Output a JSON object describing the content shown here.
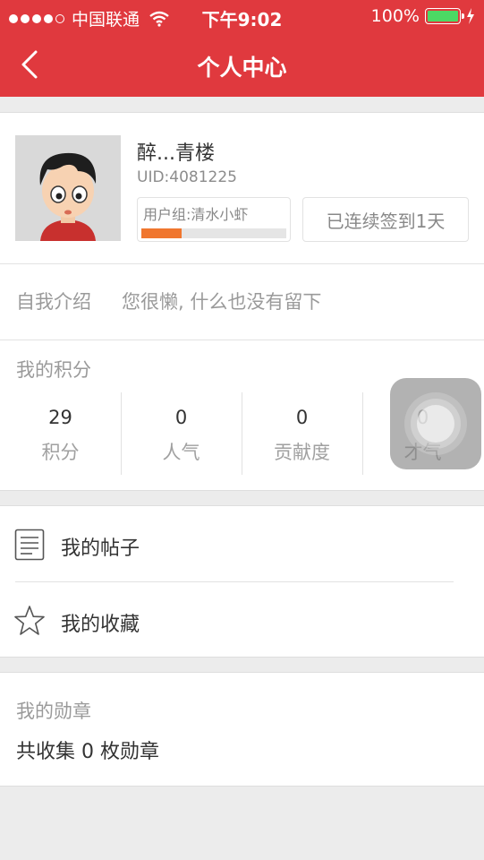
{
  "status_bar": {
    "carrier": "中国联通",
    "time": "下午9:02",
    "battery": "100%"
  },
  "navbar": {
    "title": "个人中心",
    "back_icon": "chevron-left-icon"
  },
  "profile": {
    "username": "醉...青楼",
    "uid": "UID:4081225",
    "group": "用户组:清水小虾",
    "group_progress": 0.28,
    "signin": "已连续签到1天"
  },
  "intro": {
    "label": "自我介绍",
    "text": "您很懒, 什么也没有留下"
  },
  "points": {
    "title": "我的积分",
    "items": [
      {
        "value": "29",
        "label": "积分"
      },
      {
        "value": "0",
        "label": "人气"
      },
      {
        "value": "0",
        "label": "贡献度"
      },
      {
        "value": "0",
        "label": "才气"
      }
    ]
  },
  "menu": {
    "items": [
      {
        "label": "我的帖子",
        "icon": "document-icon"
      },
      {
        "label": "我的收藏",
        "icon": "star-icon"
      }
    ]
  },
  "medals": {
    "title": "我的勋章",
    "summary": "共收集 0 枚勋章"
  },
  "colors": {
    "brand": "#e0393e",
    "progress": "#f0762e",
    "battery": "#4cd964"
  }
}
